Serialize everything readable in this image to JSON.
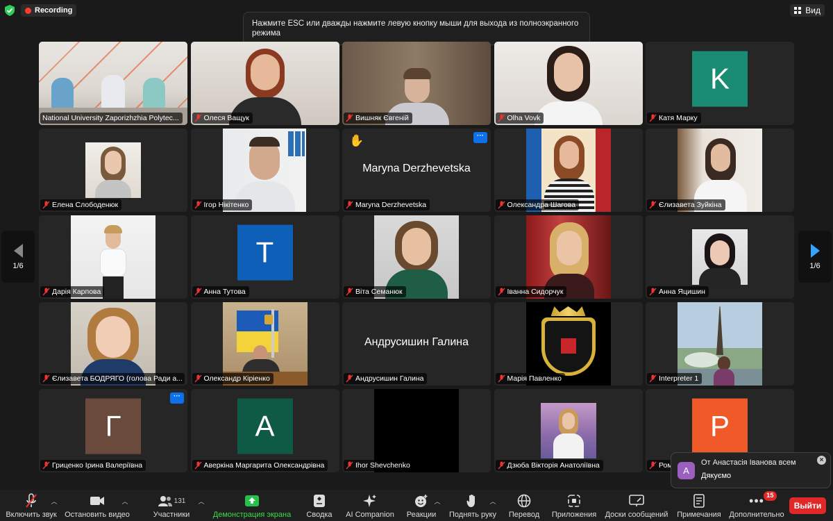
{
  "top": {
    "recording_label": "Recording",
    "view_label": "Вид",
    "esc_banner": "Нажмите ESC или дважды нажмите левую кнопку мыши для выхода из полноэкранного режима"
  },
  "gallery": {
    "page_left": "1/6",
    "page_right": "1/6",
    "tiles": [
      {
        "name": "National University Zaporizhzhia Polytec...",
        "kind": "video",
        "active": true
      },
      {
        "name": "Олеся Ващук",
        "kind": "video"
      },
      {
        "name": "Вишняк Євгеній",
        "kind": "video"
      },
      {
        "name": "Olha Vovk",
        "kind": "video"
      },
      {
        "name": "Катя Марку",
        "kind": "avatar",
        "letter": "K",
        "color": "#1a8c74"
      },
      {
        "name": "Елена Слободенюк",
        "kind": "video"
      },
      {
        "name": "Ігор Нікітенко",
        "kind": "video"
      },
      {
        "name": "Maryna Derzhevetska",
        "kind": "name",
        "bigname": "Maryna Derzhevetska"
      },
      {
        "name": "Олександра Шагова",
        "kind": "video"
      },
      {
        "name": "Єлизавета Зуйкіна",
        "kind": "video"
      },
      {
        "name": "Дарія Карпова",
        "kind": "video"
      },
      {
        "name": "Анна Тутова",
        "kind": "avatar",
        "letter": "T",
        "color": "#0d5fb8"
      },
      {
        "name": "Віта Семанюк",
        "kind": "video"
      },
      {
        "name": "Іванна Сидорчук",
        "kind": "video"
      },
      {
        "name": "Анна Яцишин",
        "kind": "video"
      },
      {
        "name": "Єлизавета БОДРЯГО (голова Ради а...",
        "kind": "video"
      },
      {
        "name": "Олександр Кіріенко",
        "kind": "video"
      },
      {
        "name": "Андрусишин Галина",
        "kind": "name",
        "bigname": "Андрусишин Галина"
      },
      {
        "name": "Марія Павленко",
        "kind": "logo",
        "logo_text": "НУ ЗП"
      },
      {
        "name": "Interpreter 1",
        "kind": "video"
      },
      {
        "name": "Гриценко Ірина Валеріївна",
        "kind": "avatar",
        "letter": "Г",
        "color": "#6b4a3e"
      },
      {
        "name": "Аверкіна Маргарита Олександрівна",
        "kind": "avatar",
        "letter": "А",
        "color": "#0f5a45"
      },
      {
        "name": "Ihor Shevchenko",
        "kind": "blank"
      },
      {
        "name": "Дзюба Вікторія Анатоліївна",
        "kind": "video"
      },
      {
        "name": "Ром",
        "kind": "avatar",
        "letter": "P",
        "color": "#f05a28"
      }
    ]
  },
  "chat": {
    "avatar_letter": "А",
    "from": "От Анастасія Іванова всем",
    "message": "Дякуємо"
  },
  "toolbar": {
    "unmute": "Включить звук",
    "stop_video": "Остановить видео",
    "participants": "Участники",
    "participants_count": "131",
    "share": "Демонстрация экрана",
    "summary": "Сводка",
    "ai": "AI Companion",
    "reactions": "Реакции",
    "raise_hand": "Поднять руку",
    "translate": "Перевод",
    "apps": "Приложения",
    "whiteboards": "Доски сообщений",
    "notes": "Примечания",
    "more": "Дополнительно",
    "more_badge": "15",
    "leave": "Выйти"
  },
  "colors": {
    "active_speaker": "#3ddc4c",
    "leave": "#e02828",
    "accent_blue": "#0e71eb"
  }
}
